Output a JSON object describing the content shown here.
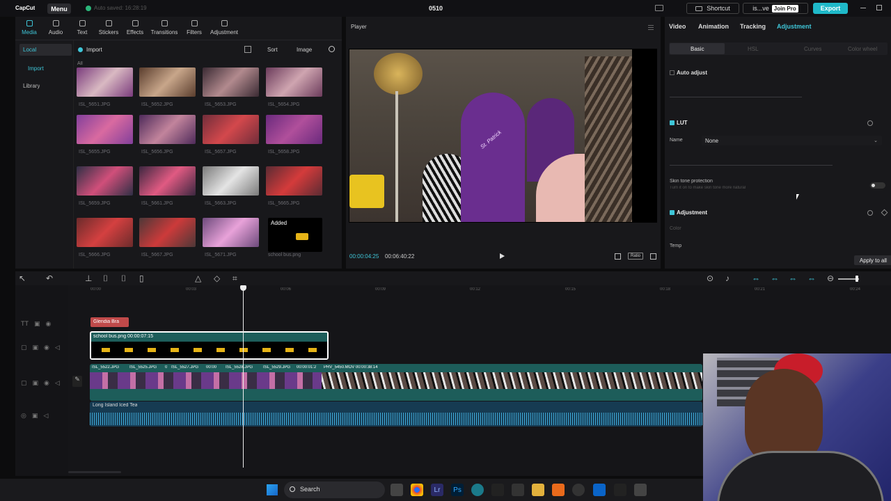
{
  "titlebar": {
    "logo": "CapCut",
    "menu": "Menu",
    "autosave": "Auto saved: 16:28:19",
    "project": "0510",
    "shortcut": "Shortcut",
    "user": "is...ve",
    "join_pro": "Join Pro",
    "export": "Export"
  },
  "toolbar": {
    "tabs": [
      {
        "label": "Media",
        "icon": "media-icon"
      },
      {
        "label": "Audio",
        "icon": "audio-icon"
      },
      {
        "label": "Text",
        "icon": "text-icon"
      },
      {
        "label": "Stickers",
        "icon": "stickers-icon"
      },
      {
        "label": "Effects",
        "icon": "effects-icon"
      },
      {
        "label": "Transitions",
        "icon": "transitions-icon"
      },
      {
        "label": "Filters",
        "icon": "filters-icon"
      },
      {
        "label": "Adjustment",
        "icon": "adjustment-icon"
      }
    ]
  },
  "sidebar": {
    "local": "Local",
    "import": "Import",
    "library": "Library"
  },
  "media": {
    "import_label": "Import",
    "sort": "Sort",
    "image": "Image",
    "all": "All",
    "added": "Added",
    "files": [
      "ISL_5651.JPG",
      "ISL_5652.JPG",
      "ISL_5653.JPG",
      "ISL_5654.JPG",
      "ISL_5655.JPG",
      "ISL_5656.JPG",
      "ISL_5657.JPG",
      "ISL_5658.JPG",
      "ISL_5659.JPG",
      "ISL_5661.JPG",
      "ISL_5663.JPG",
      "ISL_5665.JPG",
      "ISL_5666.JPG",
      "ISL_5667.JPG",
      "ISL_5671.JPG",
      "school bus.png"
    ]
  },
  "player": {
    "title": "Player",
    "current_time": "00:00:04:25",
    "total_time": "00:06:40:22",
    "ratio": "Ratio",
    "photo_banner": "St. Patrick"
  },
  "inspector": {
    "tabs": [
      "Video",
      "Animation",
      "Tracking",
      "Adjustment"
    ],
    "subtabs": [
      "Basic",
      "HSL",
      "Curves",
      "Color wheel"
    ],
    "auto_adjust": "Auto adjust",
    "lut": "LUT",
    "name_label": "Name",
    "name_value": "None",
    "skin_tone": "Skin tone protection",
    "skin_tone_hint": "Turn it on to make skin tone more natural",
    "adjustment": "Adjustment",
    "color": "Color",
    "temp": "Temp",
    "apply_all": "Apply to all"
  },
  "timeline": {
    "ruler": [
      "00:00",
      "00:03",
      "00:06",
      "00:09",
      "00:12",
      "00:15",
      "00:18",
      "00:21",
      "00:24"
    ],
    "text_clip": "Glendia Bra",
    "overlay_clip": "school bus.png  00:00:07:15",
    "video_clips": [
      "ISL_5522.JPG",
      "ISL_5525.JPG",
      "0",
      "ISL_5527.JPG",
      "00:00",
      "ISL_5528.JPG",
      "ISL_5529.JPG",
      "00:00:01:2",
      "PRV_5450.MOV  00:00:38:14"
    ],
    "audio_clip": "Long Island Iced Tea"
  },
  "taskbar": {
    "search": "Search"
  },
  "colors": {
    "accent": "#3fc6d8",
    "export": "#1fb9c9",
    "track": "#1d5d5a",
    "audio": "#1b4a66",
    "text_clip": "#c04a4a"
  }
}
